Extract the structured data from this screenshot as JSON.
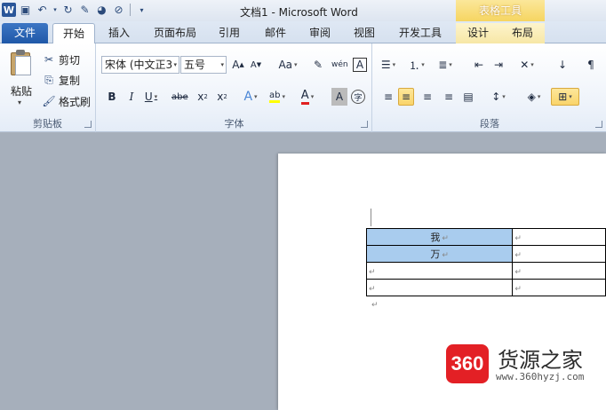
{
  "window": {
    "title": "文档1 - Microsoft Word",
    "context_group": "表格工具"
  },
  "quick_access": {
    "icons": [
      "word-logo",
      "save-icon",
      "undo-icon",
      "redo-icon",
      "format-painter-icon",
      "color-icon",
      "clear-icon",
      "customize-icon"
    ]
  },
  "tabs": [
    {
      "label": "文件"
    },
    {
      "label": "开始"
    },
    {
      "label": "插入"
    },
    {
      "label": "页面布局"
    },
    {
      "label": "引用"
    },
    {
      "label": "邮件"
    },
    {
      "label": "审阅"
    },
    {
      "label": "视图"
    },
    {
      "label": "开发工具"
    },
    {
      "label": "设计"
    },
    {
      "label": "布局"
    }
  ],
  "clipboard": {
    "paste_label": "粘贴",
    "cut_label": "剪切",
    "copy_label": "复制",
    "format_painter_label": "格式刷",
    "group_label": "剪贴板"
  },
  "font": {
    "font_name": "宋体 (中文正3",
    "font_size": "五号",
    "group_label": "字体",
    "buttons": [
      "B",
      "I",
      "U",
      "abe",
      "x₂",
      "x²",
      "A",
      "A",
      "A"
    ]
  },
  "paragraph": {
    "group_label": "段落"
  },
  "document": {
    "table": [
      [
        "我",
        ""
      ],
      [
        "万",
        ""
      ],
      [
        "",
        ""
      ],
      [
        "",
        ""
      ]
    ],
    "para_mark": "↵"
  },
  "watermark": {
    "badge": "360",
    "name": "货源之家",
    "url": "www.360hyzj.com"
  },
  "colors": {
    "file_tab": "#2a63b2",
    "selection": "#a9ccee",
    "context_tab": "#f7e3a0"
  }
}
